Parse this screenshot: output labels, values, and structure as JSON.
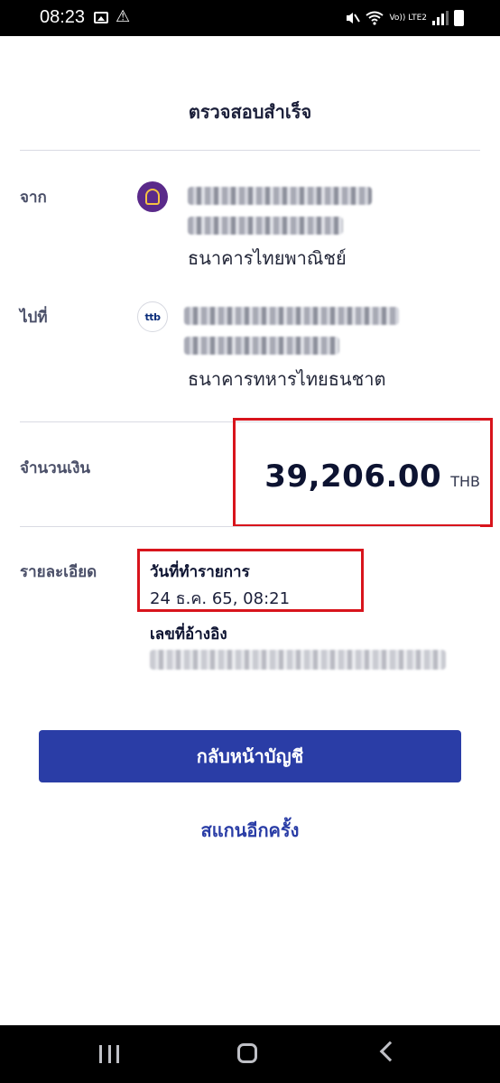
{
  "status_bar": {
    "time": "08:23",
    "warning_icon": "⚠",
    "lte_label": "Vo)) LTE2",
    "icons": [
      "image-icon",
      "warning-icon",
      "mute-icon",
      "wifi-icon",
      "signal-icon",
      "battery-icon"
    ]
  },
  "header": {
    "title": "ตรวจสอบสำเร็จ"
  },
  "from": {
    "label": "จาก",
    "bank_name": "ธนาคารไทยพาณิชย์",
    "logo_icon": "scb-bank-logo-icon"
  },
  "to": {
    "label": "ไปที่",
    "bank_name": "ธนาคารทหารไทยธนชาต",
    "logo_text": "ttb",
    "logo_icon": "ttb-bank-logo-icon"
  },
  "amount": {
    "label": "จำนวนเงิน",
    "value": "39,206.00",
    "currency": "THB"
  },
  "details": {
    "label": "รายละเอียด",
    "date_label": "วันที่ทำรายการ",
    "date_value": "24 ธ.ค. 65, 08:21",
    "ref_label": "เลขที่อ้างอิง"
  },
  "actions": {
    "back_button": "กลับหน้าบัญชี",
    "scan_again": "สแกนอีกครั้ง"
  },
  "colors": {
    "primary": "#2a3da6",
    "highlight_box": "#d8141c",
    "text_dark": "#0d1331"
  }
}
